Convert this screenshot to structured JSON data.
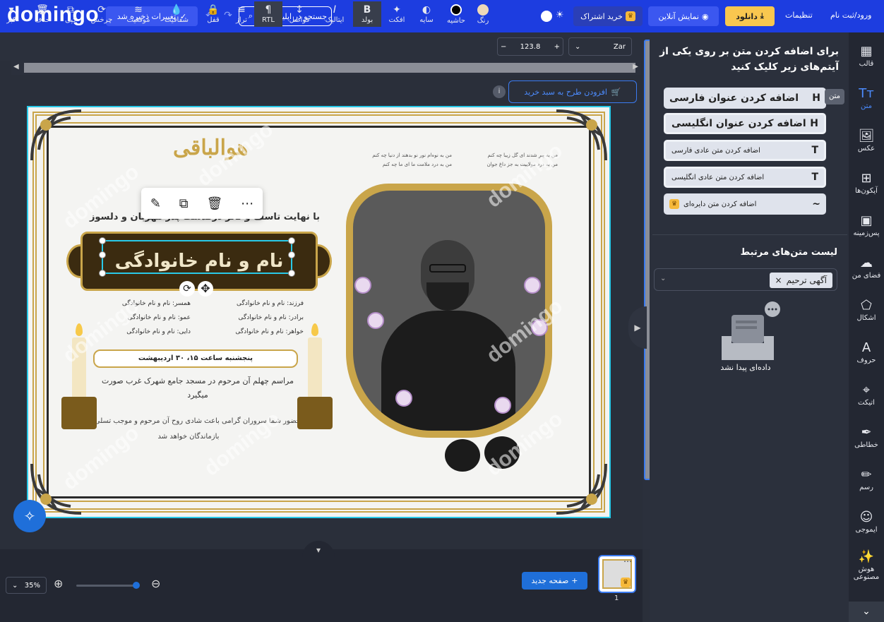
{
  "app": {
    "logo": "domingo",
    "brand_color": "#1d3de0",
    "accent": "#1f6fd9"
  },
  "header": {
    "save_label": "تغییرات ذخیره شد",
    "search_placeholder": "جستجو در اپلیکیشن...",
    "subscribe_label": "خرید اشتراک",
    "online_label": "نمایش آنلاین",
    "download_label": "دانلود",
    "settings_label": "تنظیمات",
    "login_label": "ورود/ثبت نام"
  },
  "toolbar": {
    "font_name": "Zar",
    "font_size": "123.8",
    "tools": [
      {
        "label": "رنگ",
        "icon": "color-swatch"
      },
      {
        "label": "حاشیه",
        "icon": "border-icon"
      },
      {
        "label": "سایه",
        "icon": "shadow-icon"
      },
      {
        "label": "افکت",
        "icon": "effect-icon"
      },
      {
        "label": "بولد",
        "icon": "bold-icon"
      },
      {
        "label": "ایتالیک",
        "icon": "italic-icon"
      },
      {
        "label": "فواصل",
        "icon": "spacing-icon"
      },
      {
        "label": "RTL",
        "icon": "rtl-icon"
      },
      {
        "label": "تراز",
        "icon": "align-icon"
      },
      {
        "label": "قفل",
        "icon": "lock-icon"
      },
      {
        "label": "شفافیت",
        "icon": "opacity-icon"
      },
      {
        "label": "موقعیت",
        "icon": "position-icon"
      },
      {
        "label": "چرخش",
        "icon": "rotate-icon"
      },
      {
        "label": "کپی",
        "icon": "copy-icon"
      },
      {
        "label": "حذف",
        "icon": "trash-icon"
      },
      {
        "label": "کبر",
        "icon": "more-icon"
      }
    ]
  },
  "canvas": {
    "add_to_cart": "افزودن طرح به سبد خرید",
    "watermark": "domingo",
    "card": {
      "calligraphy": "هوالباقی",
      "poem_right": [
        "من به پیرِ شدند ای گل زیبا چه کنم",
        "من به درد مولاییت به جز داغ جوان"
      ],
      "poem_left": [
        "من به نوه‌ام نور نو بدهند از دنیا چه کنم",
        "من به درد ملامت ما ای ما چه کنم"
      ],
      "sorrow_line": "با نهایت تاسف و تاثر درگذشت پدر مهربان و دلسوز",
      "name_title": "نام و نام خانوادگی",
      "relatives_right": [
        "فرزند: نام و نام خانوادگی",
        "برادر: نام و نام خانوادگی",
        "خواهر: نام و نام خانوادگی"
      ],
      "relatives_left": [
        "همسر: نام و نام خانوادگی",
        "عمو: نام و نام خانوادگی",
        "دایی: نام و نام خانوادگی"
      ],
      "date_line": "پنجشنبه ساعت ۱۵، ۳۰ اردیبهشت",
      "ceremony": "مراسم چهلم آن مرحوم در مسجد جامع شهرک غرب صورت میگیرد",
      "footer": "حضور شما سروران گرامی باعث شادی روح آن مرحوم و موجب تسلی خاطر بازماندگان خواهد شد"
    }
  },
  "bottom": {
    "zoom": "35%",
    "new_page": "صفحه جدید",
    "page_number": "1"
  },
  "panel": {
    "title": "برای اضافه کردن متن بر روی یکی از آیتم‌های زیر کلیک کنید",
    "tooltip": "متن",
    "buttons": [
      {
        "label": "اضافه کردن عنوان فارسی",
        "icon": "H"
      },
      {
        "label": "اضافه کردن عنوان انگلیسی",
        "icon": "H"
      },
      {
        "label": "اضافه کردن متن عادی فارسی",
        "icon": "T"
      },
      {
        "label": "اضافه کردن متن عادی انگلیسی",
        "icon": "T"
      },
      {
        "label": "اضافه کردن متن دایره‌ای",
        "icon": "~"
      }
    ],
    "related_title": "لیست متن‌های مرتبط",
    "related_tag": "آگهی ترحیم",
    "empty_text": "داده‌ای پیدا نشد"
  },
  "sidenav": [
    {
      "label": "قالب",
      "icon": "template-icon"
    },
    {
      "label": "متن",
      "icon": "text-icon"
    },
    {
      "label": "عکس",
      "icon": "image-icon"
    },
    {
      "label": "آیکون‌ها",
      "icon": "grid-icon"
    },
    {
      "label": "پس‌زمینه",
      "icon": "background-icon"
    },
    {
      "label": "فضای من",
      "icon": "cloud-upload-icon"
    },
    {
      "label": "اشکال",
      "icon": "shapes-icon"
    },
    {
      "label": "حروف",
      "icon": "letters-icon"
    },
    {
      "label": "اتیکت",
      "icon": "tag-icon"
    },
    {
      "label": "خطاطی",
      "icon": "feather-icon"
    },
    {
      "label": "رسم",
      "icon": "pencil-icon"
    },
    {
      "label": "ایموجی",
      "icon": "emoji-icon"
    },
    {
      "label": "هوش مصنوعی",
      "icon": "ai-icon"
    }
  ]
}
